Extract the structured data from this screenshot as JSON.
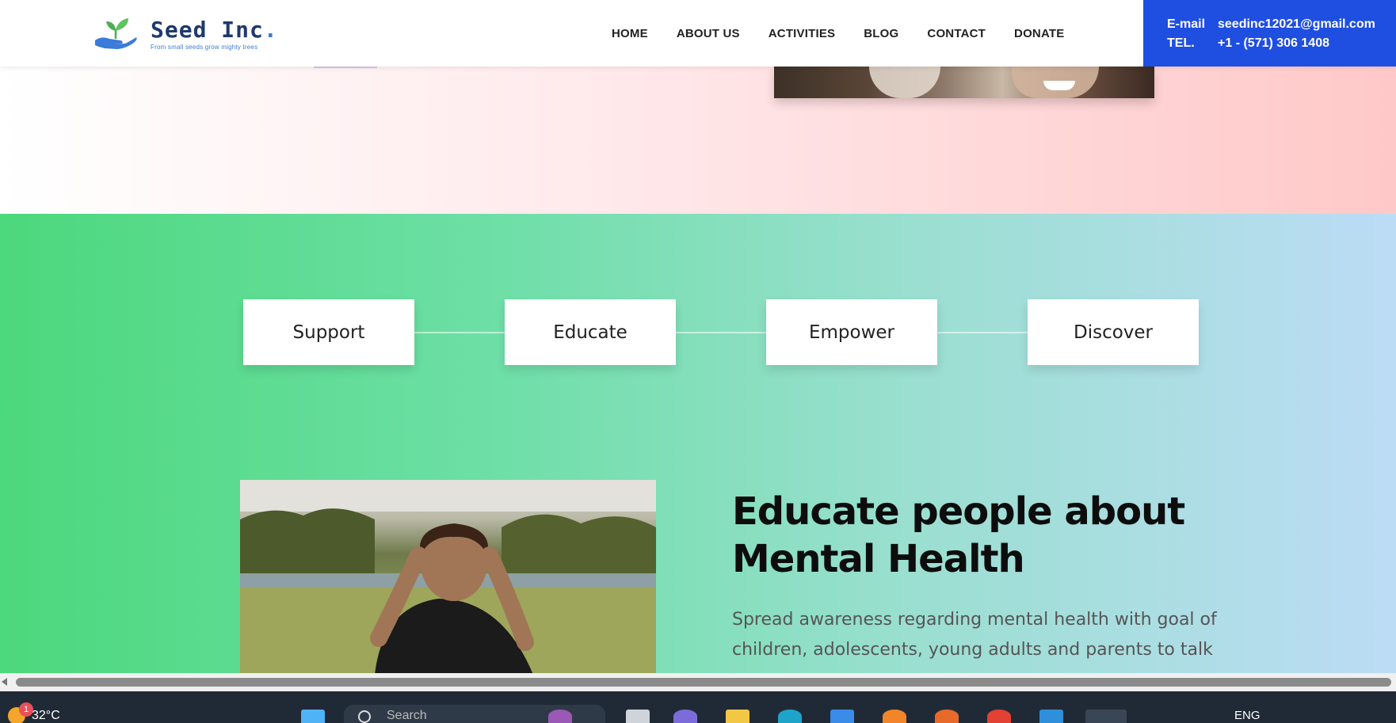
{
  "header": {
    "logo_name": "Seed Inc",
    "logo_dot": ".",
    "logo_tagline": "From small seeds grow mighty trees",
    "nav": [
      "HOME",
      "ABOUT US",
      "ACTIVITIES",
      "BLOG",
      "CONTACT",
      "DONATE"
    ],
    "contact": {
      "email_label": "E-mail",
      "email_value": "seedinc12021@gmail.com",
      "tel_label": "TEL.",
      "tel_value": "+1 - (571) 306 1408"
    }
  },
  "steps": [
    "Support",
    "Educate",
    "Empower",
    "Discover"
  ],
  "feature": {
    "title_line1": "Educate people about",
    "title_line2": "Mental Health",
    "text": "Spread awareness regarding mental health with goal of children, adolescents, young adults and parents to talk"
  },
  "taskbar": {
    "weather_temp": "32°C",
    "weather_badge": "1",
    "search_placeholder": "Search",
    "language": "ENG"
  },
  "colors": {
    "brand_blue": "#1f4fe0",
    "logo_navy": "#1e3a6e",
    "logo_leaf": "#4caf50",
    "section_green": "#4cd87c",
    "section_blue": "#bcdcf5"
  }
}
